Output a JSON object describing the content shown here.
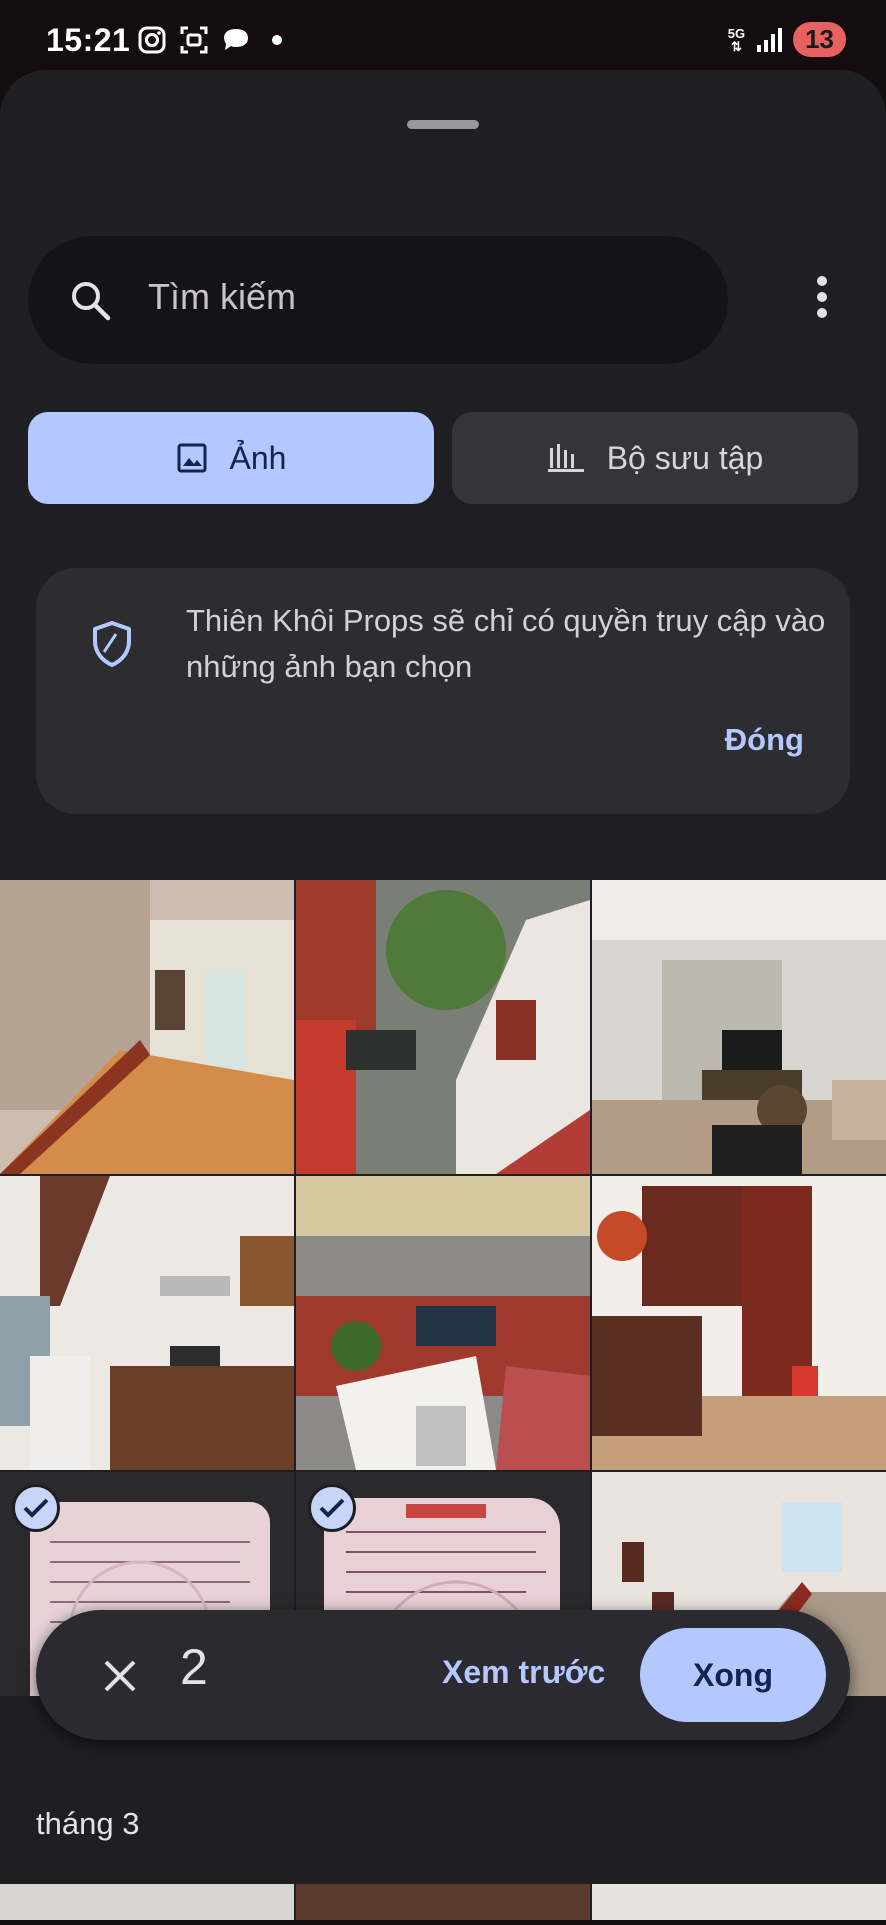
{
  "status_bar": {
    "time": "15:21",
    "network": "5G",
    "battery": "13",
    "icons": [
      "instagram-icon",
      "scan-icon",
      "chat-bubble-icon",
      "notification-dot"
    ]
  },
  "search": {
    "placeholder": "Tìm kiếm",
    "icon": "search-icon"
  },
  "tabs": [
    {
      "label": "Ảnh",
      "icon": "image-icon",
      "selected": true
    },
    {
      "label": "Bộ sưu tập",
      "icon": "album-icon",
      "selected": false
    }
  ],
  "notice": {
    "text": "Thiên Khôi Props sẽ chỉ có quyền truy cập vào những ảnh bạn chọn",
    "close_label": "Đóng",
    "icon": "shield-icon"
  },
  "photos": [
    {
      "subject": "stair-hallway",
      "selected": false
    },
    {
      "subject": "balcony-roofs",
      "selected": false
    },
    {
      "subject": "living-room",
      "selected": false
    },
    {
      "subject": "kitchen",
      "selected": false
    },
    {
      "subject": "courtyard-rooftops",
      "selected": false
    },
    {
      "subject": "red-door-room",
      "selected": false
    },
    {
      "subject": "certificate-page-1",
      "selected": true
    },
    {
      "subject": "certificate-page-2",
      "selected": true
    },
    {
      "subject": "staircase",
      "selected": false
    }
  ],
  "selection_bar": {
    "count": "2",
    "preview_label": "Xem trước",
    "done_label": "Xong"
  },
  "section_label": "tháng 3",
  "colors": {
    "accent": "#b3c8ff",
    "sheet_bg": "#1f1f23",
    "status_bg": "#140c0e"
  }
}
